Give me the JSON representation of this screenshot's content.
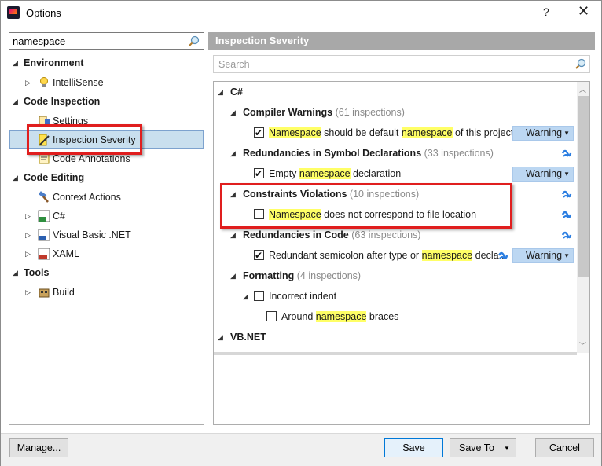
{
  "window": {
    "title": "Options",
    "help": "?",
    "close": "✕"
  },
  "left": {
    "search_value": "namespace",
    "tree": {
      "environment": "Environment",
      "intellisense": "IntelliSense",
      "code_inspection": "Code Inspection",
      "settings": "Settings",
      "inspection_severity": "Inspection Severity",
      "code_annotations": "Code Annotations",
      "code_editing": "Code Editing",
      "context_actions": "Context Actions",
      "csharp": "C#",
      "vbnet": "Visual Basic .NET",
      "xaml": "XAML",
      "tools": "Tools",
      "build": "Build"
    }
  },
  "right": {
    "header": "Inspection Severity",
    "search_placeholder": "Search",
    "lang_csharp": "C#",
    "lang_vbnet": "VB.NET",
    "groups": [
      {
        "name": "Compiler Warnings",
        "count": "(61 inspections)"
      },
      {
        "name": "Redundancies in Symbol Declarations",
        "count": "(33 inspections)"
      },
      {
        "name": "Constraints Violations",
        "count": "(10 inspections)"
      },
      {
        "name": "Redundancies in Code",
        "count": "(63 inspections)"
      },
      {
        "name": "Formatting",
        "count": "(4 inspections)"
      }
    ],
    "items": {
      "i1_a": "Namespace",
      "i1_b": " should be default ",
      "i1_c": "namespace",
      "i1_d": " of this project",
      "i2_a": "Empty ",
      "i2_b": "namespace",
      "i2_c": " declaration",
      "i3_a": "Namespace",
      "i3_b": " does not correspond to file location",
      "i4_a": "Redundant semicolon after type or ",
      "i4_b": "namespace",
      "i4_c": " decla...",
      "i5": "Incorrect indent",
      "i6_a": "Around ",
      "i6_b": "namespace",
      "i6_c": " braces"
    },
    "severity": "Warning"
  },
  "buttons": {
    "manage": "Manage...",
    "save": "Save",
    "save_to": "Save To",
    "cancel": "Cancel"
  }
}
